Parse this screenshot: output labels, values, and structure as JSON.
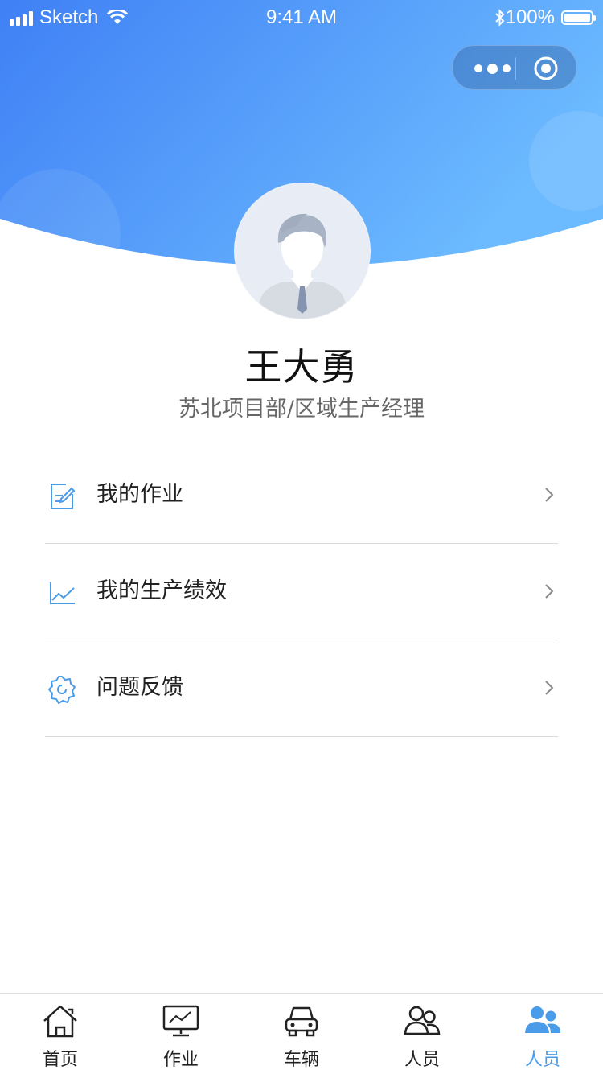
{
  "status_bar": {
    "carrier": "Sketch",
    "time": "9:41 AM",
    "battery_text": "100%",
    "battery_level": 1.0,
    "icons": [
      "signal-icon",
      "wifi-icon",
      "bluetooth-icon",
      "battery-icon"
    ]
  },
  "capsule": {
    "icons": [
      "more-icon",
      "close-target-icon"
    ]
  },
  "profile": {
    "name": "王大勇",
    "title": "苏北项目部/区域生产经理",
    "avatar_icon": "default-avatar-icon"
  },
  "menu": {
    "items": [
      {
        "label": "我的作业",
        "icon": "edit-document-icon"
      },
      {
        "label": "我的生产绩效",
        "icon": "line-chart-icon"
      },
      {
        "label": "问题反馈",
        "icon": "gear-icon"
      }
    ]
  },
  "tab_bar": {
    "tabs": [
      {
        "label": "首页",
        "icon": "home-icon"
      },
      {
        "label": "作业",
        "icon": "monitor-chart-icon"
      },
      {
        "label": "车辆",
        "icon": "car-icon"
      },
      {
        "label": "人员",
        "icon": "users-outline-icon"
      },
      {
        "label": "人员",
        "icon": "users-filled-icon"
      }
    ],
    "active_index": 4
  },
  "colors": {
    "header_gradient_start": "#3f86f6",
    "header_gradient_end": "#6ab8ff",
    "accent": "#4a9be8",
    "menu_icon": "#4a9be8"
  }
}
